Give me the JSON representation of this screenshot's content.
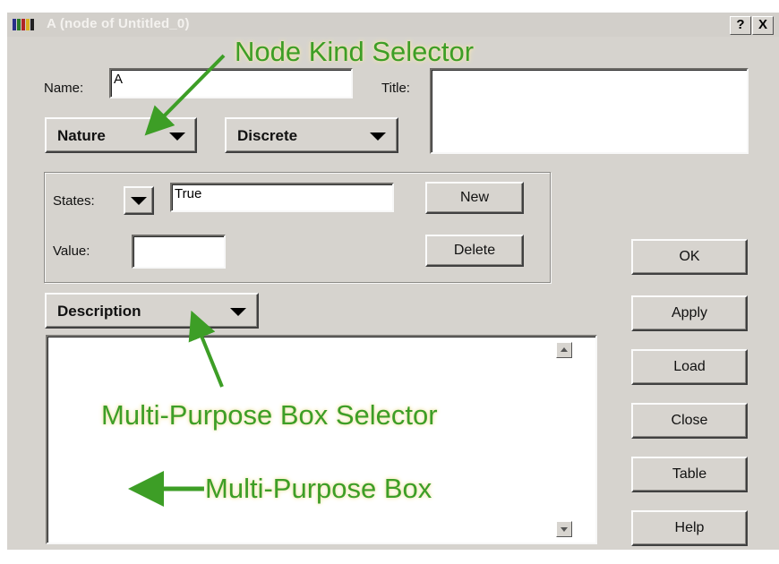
{
  "window": {
    "title": "A (node of Untitled_0)",
    "help_label": "?",
    "close_label": "X"
  },
  "form": {
    "name_label": "Name:",
    "name_value": "A",
    "title_label": "Title:",
    "title_value": "",
    "kind_selected": "Nature",
    "type_selected": "Discrete",
    "states_label": "States:",
    "states_value": "True",
    "value_label": "Value:",
    "value_value": "",
    "new_label": "New",
    "delete_label": "Delete",
    "mp_selector": "Description",
    "mp_content": ""
  },
  "side_buttons": {
    "ok": "OK",
    "apply": "Apply",
    "load": "Load",
    "close": "Close",
    "table": "Table",
    "help": "Help"
  },
  "annotations": {
    "node_kind_selector": "Node Kind Selector",
    "mp_box_selector": "Multi-Purpose Box Selector",
    "mp_box": "Multi-Purpose Box",
    "color": "#3d9e26"
  },
  "icons": [
    "app-icon",
    "chevron-down-icon",
    "scroll-up-icon",
    "scroll-down-icon",
    "arrow-icon"
  ]
}
